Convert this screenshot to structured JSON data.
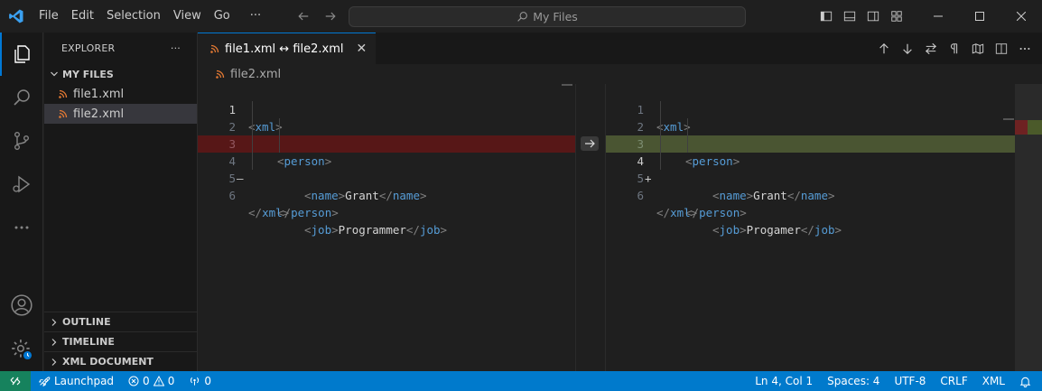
{
  "titlebar": {
    "menu": [
      "File",
      "Edit",
      "Selection",
      "View",
      "Go"
    ],
    "more": "···",
    "search_placeholder": "My Files"
  },
  "sidebar": {
    "title": "EXPLORER",
    "more": "···",
    "folder": "MY FILES",
    "files": [
      {
        "name": "file1.xml",
        "selected": false
      },
      {
        "name": "file2.xml",
        "selected": true
      }
    ],
    "sections": [
      "OUTLINE",
      "TIMELINE",
      "XML DOCUMENT"
    ]
  },
  "editor": {
    "tab_label": "file1.xml ↔ file2.xml",
    "tab_close": "✕",
    "breadcrumb": "file2.xml",
    "left_lines": [
      {
        "num": "1",
        "marker": "",
        "indent": 0,
        "open": "xml",
        "text": "",
        "close": ""
      },
      {
        "num": "2",
        "marker": "",
        "indent": 1,
        "open": "person",
        "text": "",
        "close": ""
      },
      {
        "num": "3",
        "marker": "",
        "indent": 2,
        "open": "name",
        "text": "Grant",
        "close": "name"
      },
      {
        "num": "4",
        "marker": "—",
        "indent": 2,
        "open": "job",
        "text": "Programmer",
        "close": "job",
        "removed": true
      },
      {
        "num": "5",
        "marker": "",
        "indent": 1,
        "open": "",
        "text": "",
        "close": "person"
      },
      {
        "num": "6",
        "marker": "",
        "indent": 0,
        "open": "",
        "text": "",
        "close": "xml"
      }
    ],
    "right_lines": [
      {
        "num": "1",
        "marker": "",
        "indent": 0,
        "open": "xml",
        "text": "",
        "close": ""
      },
      {
        "num": "2",
        "marker": "",
        "indent": 1,
        "open": "person",
        "text": "",
        "close": ""
      },
      {
        "num": "3",
        "marker": "",
        "indent": 2,
        "open": "name",
        "text": "Grant",
        "close": "name"
      },
      {
        "num": "4",
        "marker": "+",
        "indent": 2,
        "open": "job",
        "text": "Progamer",
        "close": "job",
        "added": true
      },
      {
        "num": "5",
        "marker": "",
        "indent": 1,
        "open": "",
        "text": "",
        "close": "person"
      },
      {
        "num": "6",
        "marker": "",
        "indent": 0,
        "open": "",
        "text": "",
        "close": "xml"
      }
    ]
  },
  "statusbar": {
    "launchpad": "Launchpad",
    "errors": "0",
    "warnings": "0",
    "ports": "0",
    "position": "Ln 4, Col 1",
    "spaces": "Spaces: 4",
    "encoding": "UTF-8",
    "eol": "CRLF",
    "language": "XML"
  },
  "colors": {
    "accent": "#0078d4",
    "statusbar": "#007acc",
    "remote": "#16825d",
    "removed_line": "#5a1d1d",
    "added_line": "#4b5a2a",
    "xml_tag": "#569cd6",
    "rss_icon": "#e37933"
  }
}
